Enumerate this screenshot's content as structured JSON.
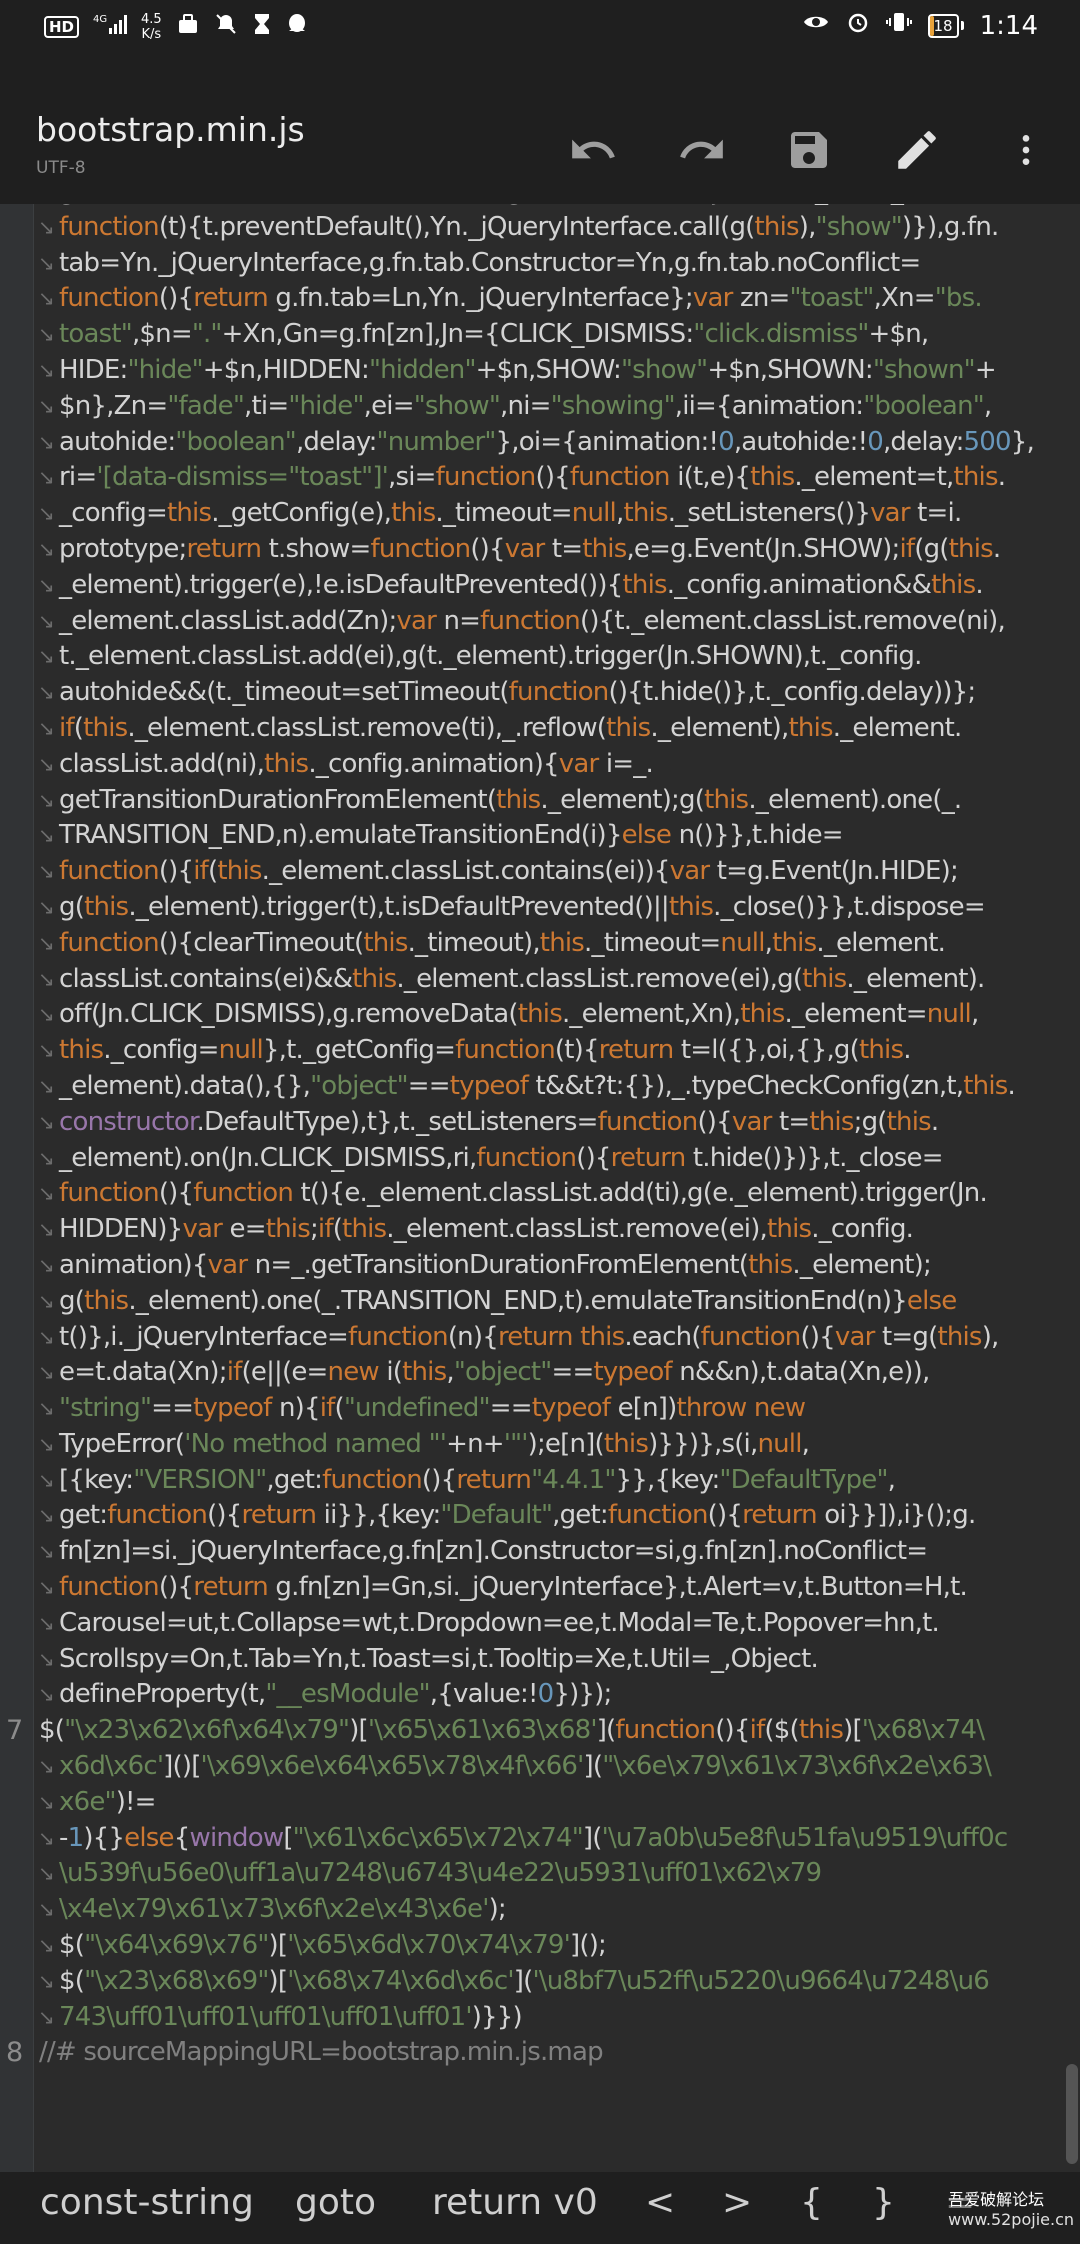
{
  "status_bar": {
    "hd": "HD",
    "signal": "4G",
    "net_speed_value": "4.5",
    "net_speed_unit": "K/s",
    "battery": "18",
    "time": "1:14"
  },
  "app_bar": {
    "title": "bootstrap.min.js",
    "subtitle": "UTF-8"
  },
  "editor": {
    "line_numbers": {
      "l7": "7",
      "l8": "8"
    },
    "wrap_marker": "↘"
  },
  "bottom_bar": {
    "items": [
      "const-string",
      "goto",
      "return v0",
      "<",
      ">",
      "{",
      "}",
      "="
    ]
  },
  "watermark": {
    "text": "吾爱破解论坛",
    "site": "www.52pojie.cn"
  },
  "colors": {
    "keyword": "#cc7832",
    "string": "#6a8759",
    "number": "#6897bb",
    "comment": "#808080",
    "background": "#2b2b2b"
  }
}
